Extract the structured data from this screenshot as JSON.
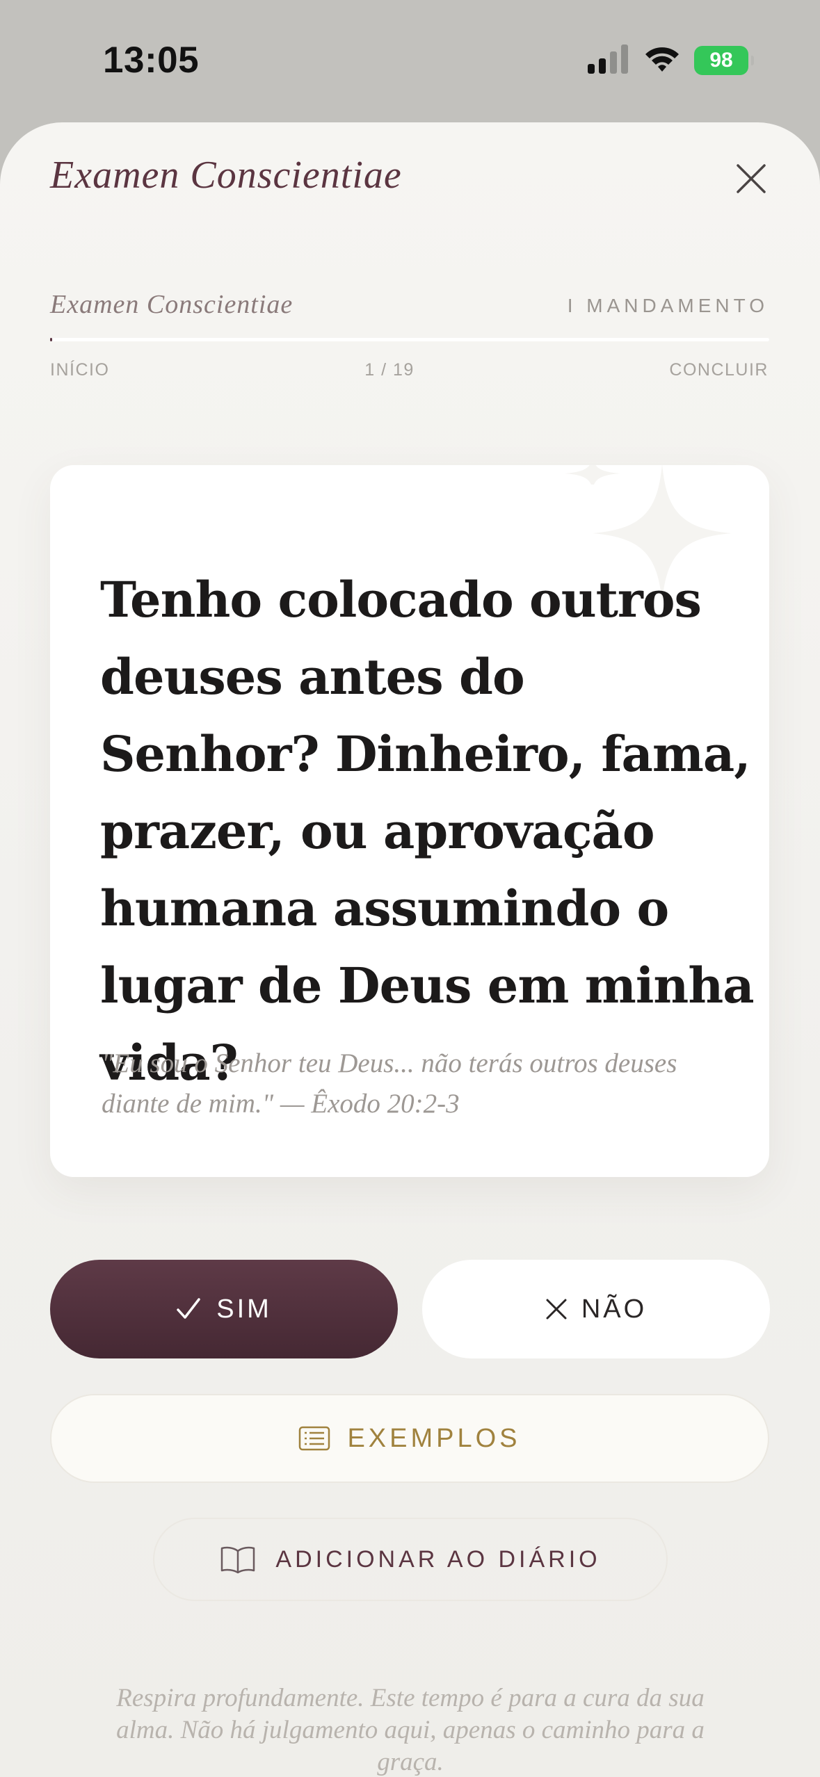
{
  "status_bar": {
    "time": "13:05",
    "battery": "98",
    "signal_icon": "cellular-signal-icon",
    "wifi_icon": "wifi-icon"
  },
  "sheet": {
    "title": "Examen Conscientiae",
    "close_icon": "close-icon"
  },
  "progress": {
    "title": "Examen Conscientiae",
    "section": "I MANDAMENTO",
    "start_label": "INÍCIO",
    "counter": "1 / 19",
    "end_label": "CONCLUIR",
    "current": 1,
    "total": 19,
    "fraction": 0.0
  },
  "card": {
    "question": "Tenho colocado outros deuses antes do Senhor? Dinheiro, fama, prazer, ou aprovação humana assumindo o lugar de Deus em minha vida?",
    "quote": "\"Eu sou o Senhor teu Deus... não terás outros deuses diante de mim.\" — Êxodo 20:2-3",
    "decoration_icon": "sparkle-icon"
  },
  "actions": {
    "yes_label": "SIM",
    "no_label": "NÃO",
    "examples_label": "EXEMPLOS",
    "journal_label": "ADICIONAR AO DIÁRIO"
  },
  "footer": {
    "text": "Respira profundamente. Este tempo é para a cura da sua alma. Não há julgamento aqui, apenas o caminho para a graça."
  },
  "colors": {
    "accent": "#5b3541",
    "gold": "#a0823e",
    "background": "#f3f2ef"
  }
}
